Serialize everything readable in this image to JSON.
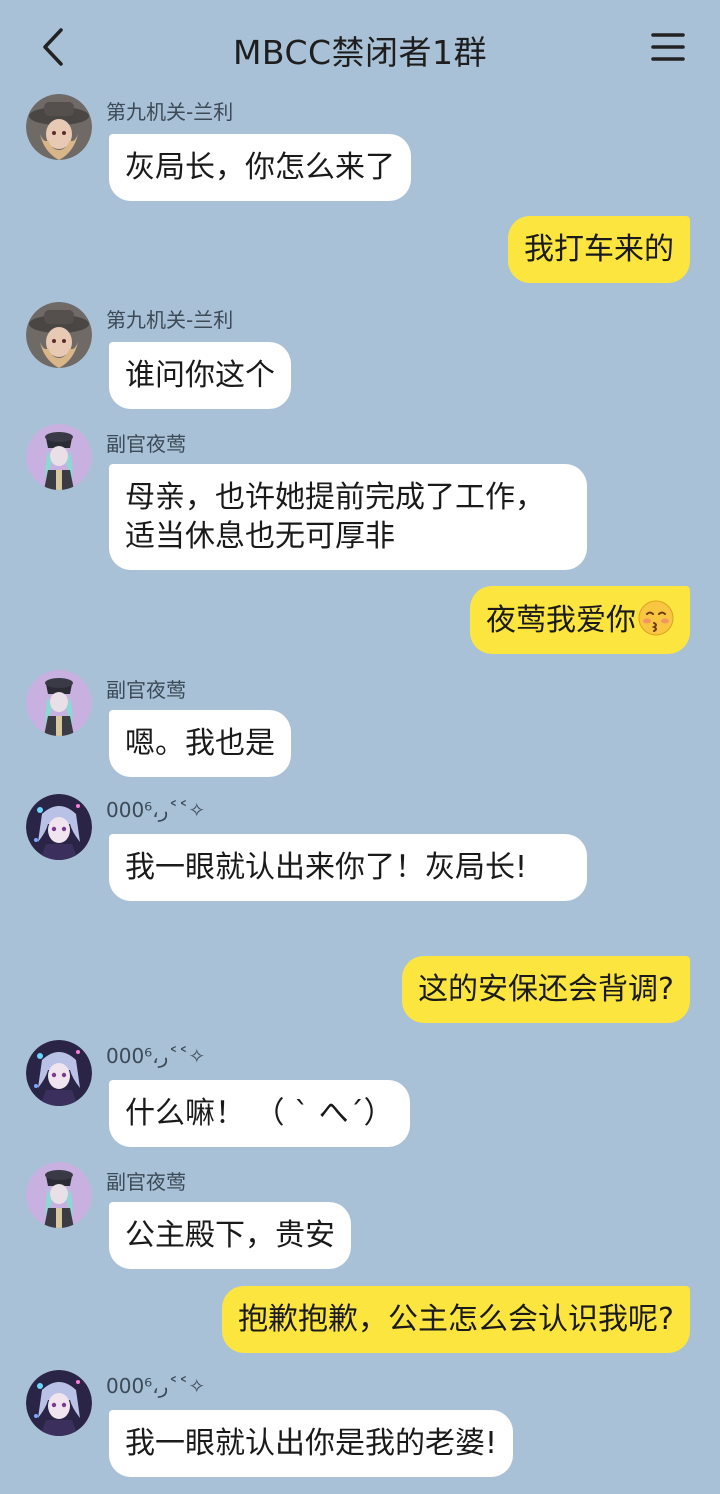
{
  "header": {
    "title": "MBCC禁闭者1群",
    "back_icon": "chevron-left-icon",
    "menu_icon": "hamburger-menu-icon"
  },
  "colors": {
    "background": "#a9c1d6",
    "incoming_bubble": "#ffffff",
    "outgoing_bubble": "#fbe53e"
  },
  "messages": [
    {
      "side": "left",
      "sender": "第九机关-兰利",
      "avatar": "avatar-lanli",
      "text": "灰局长，你怎么来了"
    },
    {
      "side": "right",
      "text": "我打车来的"
    },
    {
      "side": "left",
      "sender": "第九机关-兰利",
      "avatar": "avatar-lanli",
      "text": "谁问你这个"
    },
    {
      "side": "left",
      "sender": "副官夜莺",
      "avatar": "avatar-nightingale",
      "text": "母亲，也许她提前完成了工作，适当休息也无可厚非"
    },
    {
      "side": "right",
      "text": "夜莺我爱你",
      "emoji": "kissing-face-emoji"
    },
    {
      "side": "left",
      "sender": "副官夜莺",
      "avatar": "avatar-nightingale",
      "text": "嗯。我也是"
    },
    {
      "side": "left",
      "sender": "000⁶،ر˂˂✧",
      "avatar": "avatar-000",
      "text": "我一眼就认出来你了！灰局长!"
    },
    {
      "side": "right",
      "text": "这的安保还会背调?"
    },
    {
      "side": "left",
      "sender": "000⁶،ر˂˂✧",
      "avatar": "avatar-000",
      "text": "什么嘛！ （ ` へ´）"
    },
    {
      "side": "left",
      "sender": "副官夜莺",
      "avatar": "avatar-nightingale",
      "text": "公主殿下，贵安"
    },
    {
      "side": "right",
      "text": "抱歉抱歉，公主怎么会认识我呢?"
    },
    {
      "side": "left",
      "sender": "000⁶،ر˂˂✧",
      "avatar": "avatar-000",
      "text": "我一眼就认出你是我的老婆!"
    }
  ]
}
